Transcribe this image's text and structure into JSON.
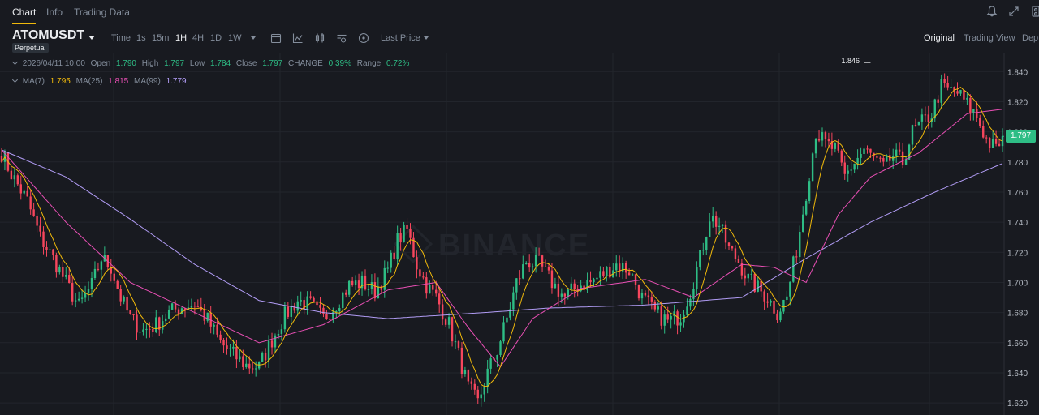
{
  "tabs": [
    {
      "label": "Chart",
      "active": true
    },
    {
      "label": "Info",
      "active": false
    },
    {
      "label": "Trading Data",
      "active": false
    }
  ],
  "toolbar": {
    "symbol": "ATOMUSDT",
    "badge": "Perpetual",
    "time_label": "Time",
    "intervals": [
      {
        "label": "1s",
        "active": false
      },
      {
        "label": "15m",
        "active": false
      },
      {
        "label": "1H",
        "active": true
      },
      {
        "label": "4H",
        "active": false
      },
      {
        "label": "1D",
        "active": false
      },
      {
        "label": "1W",
        "active": false
      }
    ],
    "icons": [
      "calendar-icon",
      "indicator-icon",
      "candle-type-icon",
      "settings-icon",
      "add-icon"
    ],
    "price_type": "Last Price",
    "views": [
      {
        "label": "Original",
        "active": true
      },
      {
        "label": "Trading View",
        "active": false
      },
      {
        "label": "Depth",
        "active": false
      }
    ]
  },
  "top_icons": [
    "bell-icon",
    "expand-icon",
    "layout-icon"
  ],
  "ohlc": {
    "date": "2026/04/11 10:00",
    "open_label": "Open",
    "open": "1.790",
    "high_label": "High",
    "high": "1.797",
    "low_label": "Low",
    "low": "1.784",
    "close_label": "Close",
    "close": "1.797",
    "change_label": "CHANGE",
    "change": "0.39%",
    "range_label": "Range",
    "range": "0.72%"
  },
  "ma": {
    "ma7_label": "MA(7)",
    "ma7": "1.795",
    "ma25_label": "MA(25)",
    "ma25": "1.815",
    "ma99_label": "MA(99)",
    "ma99": "1.779"
  },
  "colors": {
    "up": "#2ebd85",
    "down": "#f6465d",
    "ma7": "#f0b90b",
    "ma25": "#e84fb4",
    "ma99": "#b19cf5",
    "accent": "#f0b90b",
    "grid": "#22252c"
  },
  "watermark": "BINANCE",
  "chart_data": {
    "type": "candlestick",
    "y_ticks": [
      "1.840",
      "1.820",
      "1.800",
      "1.780",
      "1.760",
      "1.740",
      "1.720",
      "1.700",
      "1.680",
      "1.660",
      "1.640",
      "1.620"
    ],
    "ylim": [
      1.612,
      1.852
    ],
    "last_price": "1.797",
    "high_marker": "1.846",
    "grid": true,
    "close_path": [
      [
        0,
        1.786
      ],
      [
        3,
        1.772
      ],
      [
        8,
        1.754
      ],
      [
        12,
        1.73
      ],
      [
        16,
        1.716
      ],
      [
        20,
        1.7
      ],
      [
        24,
        1.684
      ],
      [
        28,
        1.698
      ],
      [
        31,
        1.716
      ],
      [
        34,
        1.71
      ],
      [
        37,
        1.69
      ],
      [
        40,
        1.676
      ],
      [
        44,
        1.668
      ],
      [
        48,
        1.672
      ],
      [
        52,
        1.68
      ],
      [
        56,
        1.684
      ],
      [
        60,
        1.686
      ],
      [
        64,
        1.675
      ],
      [
        68,
        1.66
      ],
      [
        72,
        1.652
      ],
      [
        76,
        1.645
      ],
      [
        80,
        1.644
      ],
      [
        84,
        1.662
      ],
      [
        88,
        1.678
      ],
      [
        92,
        1.688
      ],
      [
        96,
        1.685
      ],
      [
        100,
        1.676
      ],
      [
        104,
        1.686
      ],
      [
        108,
        1.698
      ],
      [
        112,
        1.7
      ],
      [
        116,
        1.694
      ],
      [
        120,
        1.708
      ],
      [
        123,
        1.728
      ],
      [
        126,
        1.735
      ],
      [
        129,
        1.712
      ],
      [
        132,
        1.698
      ],
      [
        135,
        1.69
      ],
      [
        139,
        1.672
      ],
      [
        142,
        1.652
      ],
      [
        145,
        1.63
      ],
      [
        148,
        1.62
      ],
      [
        151,
        1.64
      ],
      [
        154,
        1.655
      ],
      [
        157,
        1.676
      ],
      [
        160,
        1.7
      ],
      [
        163,
        1.714
      ],
      [
        167,
        1.712
      ],
      [
        171,
        1.7
      ],
      [
        175,
        1.69
      ],
      [
        179,
        1.698
      ],
      [
        183,
        1.7
      ],
      [
        187,
        1.706
      ],
      [
        191,
        1.712
      ],
      [
        195,
        1.708
      ],
      [
        199,
        1.69
      ],
      [
        203,
        1.68
      ],
      [
        207,
        1.674
      ],
      [
        211,
        1.678
      ],
      [
        214,
        1.694
      ],
      [
        217,
        1.716
      ],
      [
        220,
        1.744
      ],
      [
        223,
        1.738
      ],
      [
        226,
        1.722
      ],
      [
        229,
        1.714
      ],
      [
        232,
        1.702
      ],
      [
        235,
        1.696
      ],
      [
        238,
        1.69
      ],
      [
        241,
        1.68
      ],
      [
        244,
        1.69
      ],
      [
        247,
        1.722
      ],
      [
        250,
        1.76
      ],
      [
        253,
        1.8
      ],
      [
        256,
        1.792
      ],
      [
        259,
        1.788
      ],
      [
        262,
        1.77
      ],
      [
        265,
        1.78
      ],
      [
        268,
        1.788
      ],
      [
        271,
        1.782
      ],
      [
        274,
        1.776
      ],
      [
        277,
        1.784
      ],
      [
        280,
        1.78
      ],
      [
        283,
        1.8
      ],
      [
        286,
        1.806
      ],
      [
        289,
        1.812
      ],
      [
        292,
        1.83
      ],
      [
        294,
        1.828
      ],
      [
        297,
        1.826
      ],
      [
        300,
        1.818
      ],
      [
        303,
        1.81
      ],
      [
        306,
        1.795
      ],
      [
        309,
        1.788
      ],
      [
        311,
        1.797
      ]
    ],
    "ma25_path": [
      [
        0,
        1.788
      ],
      [
        20,
        1.74
      ],
      [
        40,
        1.7
      ],
      [
        60,
        1.68
      ],
      [
        80,
        1.66
      ],
      [
        100,
        1.672
      ],
      [
        120,
        1.695
      ],
      [
        135,
        1.7
      ],
      [
        145,
        1.67
      ],
      [
        155,
        1.644
      ],
      [
        165,
        1.676
      ],
      [
        180,
        1.696
      ],
      [
        200,
        1.702
      ],
      [
        215,
        1.69
      ],
      [
        230,
        1.712
      ],
      [
        240,
        1.71
      ],
      [
        250,
        1.7
      ],
      [
        260,
        1.745
      ],
      [
        270,
        1.77
      ],
      [
        285,
        1.786
      ],
      [
        300,
        1.812
      ],
      [
        311,
        1.815
      ]
    ],
    "ma99_path": [
      [
        0,
        1.788
      ],
      [
        20,
        1.77
      ],
      [
        40,
        1.742
      ],
      [
        60,
        1.712
      ],
      [
        80,
        1.688
      ],
      [
        100,
        1.68
      ],
      [
        120,
        1.676
      ],
      [
        150,
        1.68
      ],
      [
        170,
        1.683
      ],
      [
        200,
        1.685
      ],
      [
        230,
        1.69
      ],
      [
        250,
        1.716
      ],
      [
        270,
        1.74
      ],
      [
        290,
        1.76
      ],
      [
        311,
        1.779
      ]
    ]
  }
}
